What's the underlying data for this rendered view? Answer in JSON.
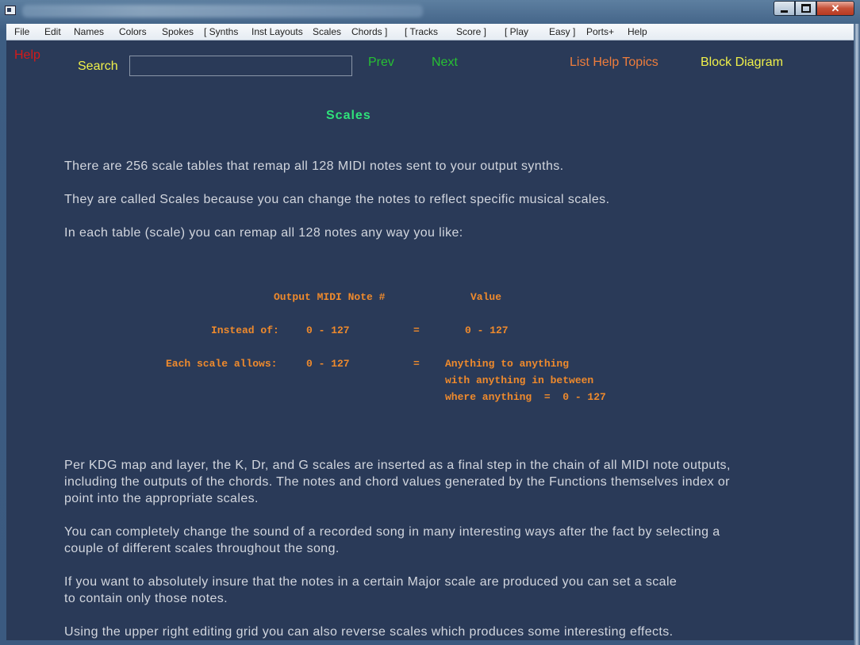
{
  "menu": [
    "File",
    "Edit",
    "Names",
    "Colors",
    "Spokes",
    "[  Synths",
    "Inst Layouts",
    "Scales",
    "Chords  ]",
    "[  Tracks",
    "Score  ]",
    "[  Play",
    "Easy  ]",
    "Ports+",
    "Help"
  ],
  "header": {
    "help_label": "Help",
    "search_label": "Search",
    "search_value": "",
    "prev": "Prev",
    "next": "Next",
    "list_topics": "List Help Topics",
    "block_diagram": "Block Diagram"
  },
  "page": {
    "title": "Scales",
    "intro": [
      "There are 256 scale tables that remap all 128 MIDI notes sent to your output synths.",
      "They are called Scales because you can change the notes to reflect specific musical scales.",
      "In each table (scale) you can remap all 128 notes any way you like:"
    ],
    "table": {
      "header_note": "Output MIDI Note #",
      "header_value": "Value",
      "row1_label": "Instead of:",
      "row1_note": "0 - 127",
      "row1_eq": "=",
      "row1_value": "0 - 127",
      "row2_label": "Each scale allows:",
      "row2_note": "0 - 127",
      "row2_eq": "=",
      "row2_value_lines": [
        "Anything to anything",
        "with anything in between",
        "where anything  =  0 - 127"
      ]
    },
    "body": [
      "Per KDG map and layer, the K, Dr, and G scales are inserted as a final step in the chain of all MIDI note outputs, including the outputs of the chords.  The notes and chord values generated by the Functions themselves index or point into the appropriate scales.",
      "You can completely change the sound of a recorded song in many interesting ways after the fact by selecting a couple of different scales throughout the song.",
      "If you want to absolutely insure that the notes in a certain Major scale are produced you can set a scale to contain only those notes.",
      "Using the upper right editing grid you can also reverse scales which produces some interesting effects."
    ]
  }
}
